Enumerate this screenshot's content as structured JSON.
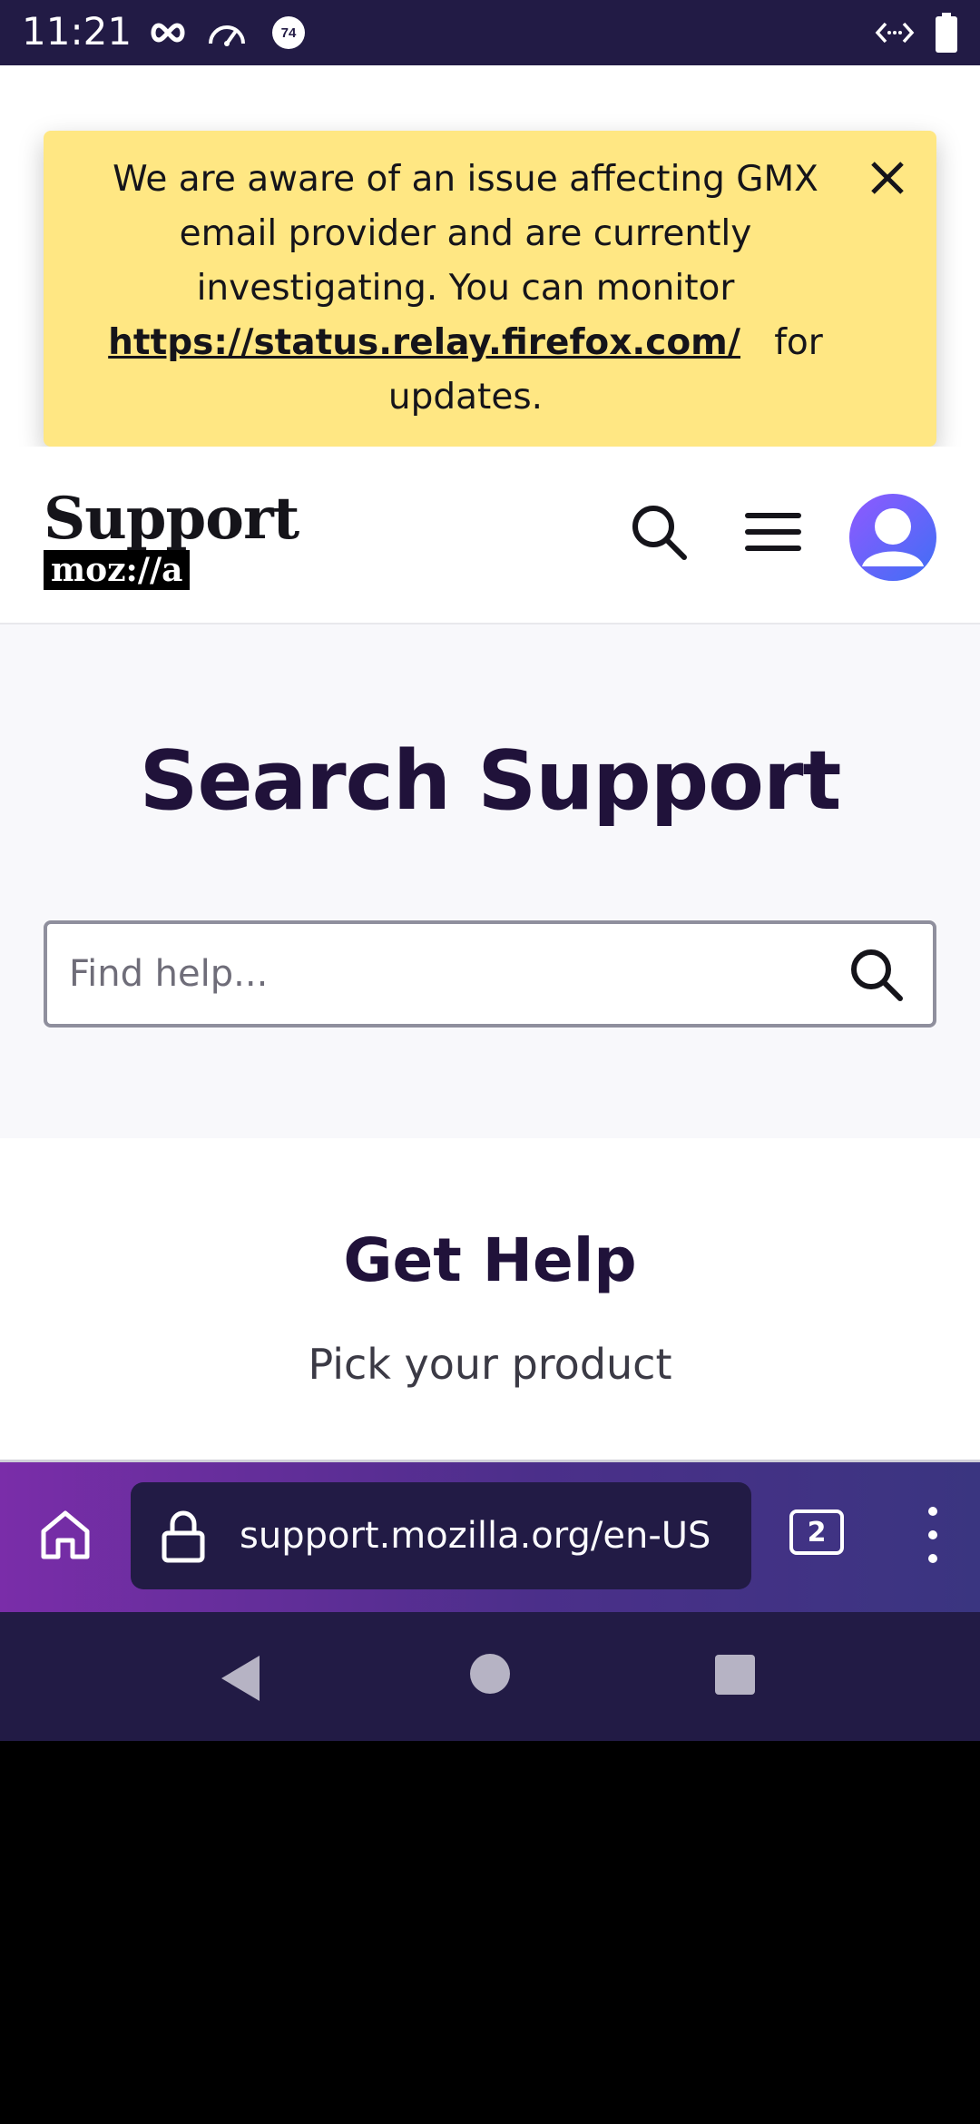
{
  "status_bar": {
    "time": "11:21",
    "notification_badge": "74",
    "icons": [
      "infinity-icon",
      "gauge-icon",
      "badge-icon",
      "code-icon",
      "battery-icon"
    ]
  },
  "banner": {
    "text_before": "We are aware of an issue affecting GMX email provider and are currently investigating. You can monitor",
    "link_text": "https://status.relay.firefox.com/",
    "text_after": "for updates.",
    "background": "#ffe783"
  },
  "header": {
    "logo_title": "Support",
    "logo_brand": "moz://a"
  },
  "search_section": {
    "title": "Search Support",
    "placeholder": "Find help..."
  },
  "get_help": {
    "title": "Get Help",
    "subtitle": "Pick your product"
  },
  "browser_toolbar": {
    "url": "support.mozilla.org/en-US",
    "tab_count": "2"
  },
  "colors": {
    "dark_purple": "#221b45",
    "heading": "#20123a",
    "banner": "#ffe783"
  }
}
